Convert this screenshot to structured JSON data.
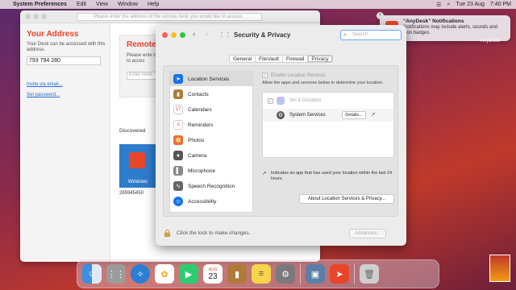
{
  "menubar": {
    "apple": "",
    "items": [
      "System Preferences",
      "Edit",
      "View",
      "Window",
      "Help"
    ],
    "date": "Tue 23 Aug",
    "time": "7:40 PM"
  },
  "anydesk": {
    "address_placeholder": "Please enter the address of the remote desk you would like to access.",
    "your_address_title": "Your Address",
    "warning_text": "Your Desk can be accessed with this address.",
    "id": "793 794 280",
    "invite_link": "Invite via email...",
    "set_password_link": "Set password...",
    "remote_title": "Remote",
    "remote_sub": "Please ente is like to acces",
    "remote_input_placeholder": "Enter Rem",
    "discovered_label": "Discovered",
    "tile_label": "Windows",
    "tile_id": "265945450",
    "notif_label": "AnyDesk"
  },
  "security": {
    "title": "Security & Privacy",
    "search_placeholder": "Search",
    "tabs": [
      "General",
      "FileVault",
      "Firewall",
      "Privacy"
    ],
    "active_tab": "Privacy",
    "sidebar": [
      {
        "label": "Location Services",
        "icon": "location-arrow-icon",
        "color": "#1a73e8",
        "selected": true
      },
      {
        "label": "Contacts",
        "icon": "contacts-book-icon",
        "color": "#b07a3a"
      },
      {
        "label": "Calendars",
        "icon": "calendar-icon",
        "color": "#e74c3c"
      },
      {
        "label": "Reminders",
        "icon": "reminders-list-icon",
        "color": "#f0f0f0"
      },
      {
        "label": "Photos",
        "icon": "photos-flower-icon",
        "color": "#f5a623"
      },
      {
        "label": "Camera",
        "icon": "camera-icon",
        "color": "#555"
      },
      {
        "label": "Microphone",
        "icon": "microphone-icon",
        "color": "#888"
      },
      {
        "label": "Speech Recognition",
        "icon": "speech-recognition-icon",
        "color": "#666"
      },
      {
        "label": "Accessibility",
        "icon": "accessibility-icon",
        "color": "#1a73e8"
      }
    ],
    "enable_location": "Enable Location Services",
    "description": "Allow the apps and services below to determine your location.",
    "rows": [
      {
        "label": "Siri & Dictation",
        "dim": true
      },
      {
        "label": "System Services",
        "dim": false,
        "button": "Details..."
      }
    ],
    "info_text": "Indicates an app that has used your location within the last 24 hours.",
    "about_button": "About Location Services & Privacy...",
    "lock_text": "Click the lock to make changes.",
    "advanced_button": "Advanced..."
  },
  "notification": {
    "title": "“AnyDesk” Notifications",
    "body": "Notifications may include alerts, sounds and icon badges."
  },
  "dock": {
    "icons": [
      {
        "name": "finder-icon",
        "color": "#3b8fe0"
      },
      {
        "name": "launchpad-icon",
        "color": "#9b9b9b"
      },
      {
        "name": "safari-icon",
        "color": "#2a7fd4"
      },
      {
        "name": "photos-icon",
        "color": "#f5a623"
      },
      {
        "name": "facetime-icon",
        "color": "#2ecc71"
      },
      {
        "name": "calendar-icon",
        "color": "#ffffff"
      },
      {
        "name": "contacts-icon",
        "color": "#b07a3a"
      },
      {
        "name": "notes-icon",
        "color": "#f7d54a"
      },
      {
        "name": "system-preferences-icon",
        "color": "#7a7a7a"
      },
      {
        "name": "preview-icon",
        "color": "#5a7fa8"
      },
      {
        "name": "anydesk-icon",
        "color": "#e8462a"
      },
      {
        "name": "trash-icon",
        "color": "#cfcfcf"
      }
    ],
    "calendar_month": "AUG",
    "calendar_day": "23"
  }
}
